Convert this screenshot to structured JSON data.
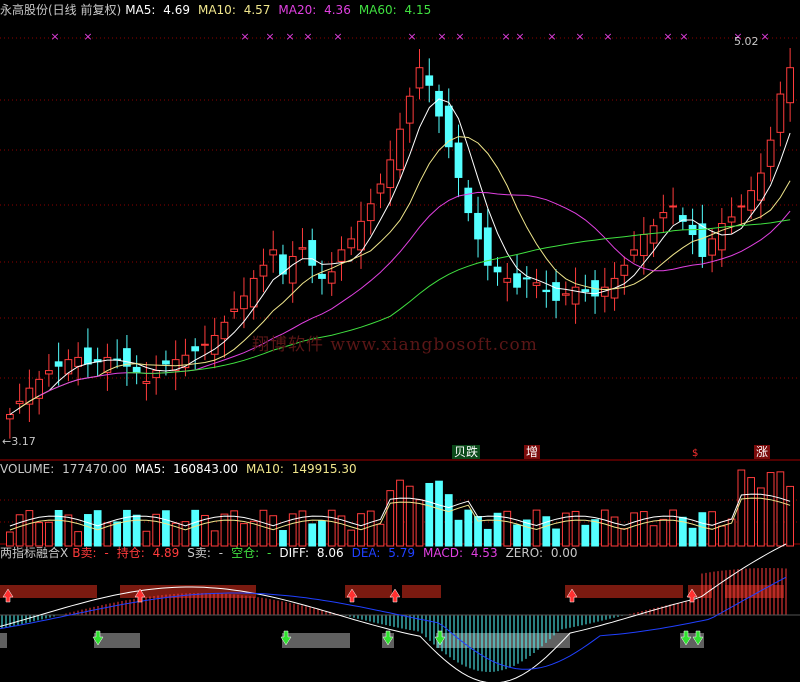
{
  "header": {
    "stock": "永高股份(日线 前复权)",
    "ma5": {
      "label": "MA5:",
      "value": "4.69",
      "color": "#ffffff"
    },
    "ma10": {
      "label": "MA10:",
      "value": "4.57",
      "color": "#f0e68c"
    },
    "ma20": {
      "label": "MA20:",
      "value": "4.36",
      "color": "#e040e0"
    },
    "ma60": {
      "label": "MA60:",
      "value": "4.15",
      "color": "#40e040"
    }
  },
  "price": {
    "max_label": "5.02",
    "min_label": "3.17",
    "max_value": 5.02,
    "min_value": 3.17
  },
  "watermark": "翔博软件 www.xiangbosoft.com",
  "signals": {
    "die": "跌",
    "zeng": "增",
    "zhang": "涨",
    "die_small": "跌"
  },
  "volume_header": {
    "volume": {
      "label": "VOLUME:",
      "value": "177470.00"
    },
    "ma5": {
      "label": "MA5:",
      "value": "160843.00"
    },
    "ma10": {
      "label": "MA10:",
      "value": "149915.30"
    }
  },
  "indicator_header": {
    "name": "两指标融合X",
    "b_sell": {
      "label": "B卖:",
      "value": "-"
    },
    "hold": {
      "label": "持仓:",
      "value": "4.89"
    },
    "s_sell": {
      "label": "S卖:",
      "value": "-"
    },
    "empty": {
      "label": "空仓:",
      "value": "-"
    },
    "diff": {
      "label": "DIFF:",
      "value": "8.06"
    },
    "dea": {
      "label": "DEA:",
      "value": "5.79"
    },
    "macd": {
      "label": "MACD:",
      "value": "4.53"
    },
    "zero": {
      "label": "ZERO:",
      "value": "0.00"
    }
  },
  "colors": {
    "up": "#ff3c3c",
    "down": "#54ffff",
    "grid": "#8b0000",
    "ma5": "#ffffff",
    "ma10": "#f0e68c",
    "ma20": "#e040e0",
    "ma60": "#40e040",
    "diff": "#ffffff",
    "dea": "#2040ff",
    "hold_bar": "#7a1a10",
    "empty_bar": "#606060"
  },
  "chart_data": {
    "type": "candlestick",
    "price_range": [
      3.17,
      5.02
    ],
    "closes": [
      3.3,
      3.36,
      3.42,
      3.46,
      3.5,
      3.52,
      3.55,
      3.56,
      3.53,
      3.54,
      3.56,
      3.55,
      3.52,
      3.49,
      3.45,
      3.5,
      3.53,
      3.55,
      3.57,
      3.59,
      3.62,
      3.66,
      3.72,
      3.78,
      3.84,
      3.92,
      3.98,
      4.05,
      3.94,
      4.02,
      4.06,
      3.98,
      3.92,
      3.95,
      4.05,
      4.1,
      4.18,
      4.26,
      4.35,
      4.46,
      4.6,
      4.75,
      4.88,
      4.8,
      4.66,
      4.52,
      4.38,
      4.22,
      4.1,
      3.98,
      3.95,
      3.92,
      3.88,
      3.92,
      3.9,
      3.86,
      3.82,
      3.85,
      3.88,
      3.86,
      3.84,
      3.88,
      3.92,
      3.98,
      4.05,
      4.12,
      4.16,
      4.22,
      4.25,
      4.18,
      4.12,
      4.02,
      4.1,
      4.17,
      4.2,
      4.25,
      4.32,
      4.4,
      4.55,
      4.76,
      4.88
    ],
    "volume_range": [
      0,
      360000
    ],
    "macd_range": [
      -10,
      10
    ]
  }
}
